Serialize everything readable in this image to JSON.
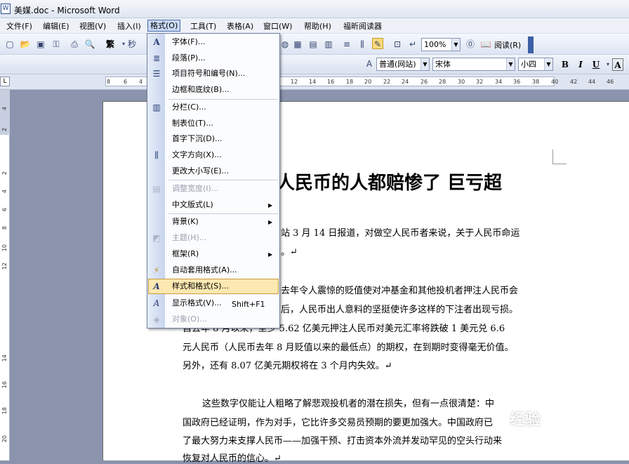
{
  "window": {
    "title": "美媒.doc - Microsoft Word"
  },
  "menubar": {
    "items": [
      "文件(F)",
      "编辑(E)",
      "视图(V)",
      "插入(I)",
      "格式(O)",
      "工具(T)",
      "表格(A)",
      "窗口(W)",
      "帮助(H)",
      "福昕阅读器"
    ]
  },
  "toolbar": {
    "zoom": "100%",
    "read_label": "阅读(R)",
    "char_label": "繁"
  },
  "format_toolbar": {
    "style": "普通(网站)",
    "font": "宋体",
    "size": "小四",
    "bold": "B",
    "italic": "I",
    "underline": "U",
    "fontcolor": "A"
  },
  "ruler": {
    "numbers": [
      "8",
      "6",
      "4",
      "12",
      "14",
      "16",
      "18",
      "20",
      "22",
      "24",
      "26",
      "28",
      "30",
      "32",
      "34",
      "36",
      "38",
      "40",
      "42",
      "44",
      "46"
    ]
  },
  "vruler": {
    "numbers": [
      "4",
      "2",
      "2",
      "4",
      "6",
      "8",
      "10",
      "12",
      "14",
      "16",
      "18",
      "20"
    ]
  },
  "format_menu": {
    "items": [
      {
        "label": "字体(F)...",
        "icon": "A"
      },
      {
        "label": "段落(P)...",
        "icon": "≣"
      },
      {
        "label": "项目符号和编号(N)...",
        "icon": "☰"
      },
      {
        "label": "边框和底纹(B)...",
        "icon": ""
      },
      {
        "label": "分栏(C)...",
        "icon": "▥"
      },
      {
        "label": "制表位(T)...",
        "icon": ""
      },
      {
        "label": "首字下沉(D)...",
        "icon": ""
      },
      {
        "label": "文字方向(X)...",
        "icon": "⫼"
      },
      {
        "label": "更改大小写(E)...",
        "icon": ""
      },
      {
        "label": "调整宽度(I)...",
        "icon": "▤"
      },
      {
        "label": "中文版式(L)",
        "icon": ""
      },
      {
        "label": "背景(K)",
        "icon": ""
      },
      {
        "label": "主题(H)...",
        "icon": "◩"
      },
      {
        "label": "框架(R)",
        "icon": ""
      },
      {
        "label": "自动套用格式(A)...",
        "icon": "⚡"
      },
      {
        "label": "样式和格式(S)...",
        "icon": "A"
      },
      {
        "label": "显示格式(V)...",
        "icon": "A"
      },
      {
        "label": "对象(O)...",
        "icon": "◈"
      }
    ],
    "shortcut": "Shift+F1"
  },
  "document": {
    "title_partial": "空人民币的人都赔惨了 巨亏超",
    "lines": [
      "站 3 月 14 日报道，对做空人民币者来说，关于人民币命运",
      "。↵",
      "去年令人震惊的贬值使对冲基金和其他投机者押注人民币会",
      "后，人民币出人意料的坚挺使许多这样的下注者出现亏损。",
      "自去年 8 月以来，至少 5.62 亿美元押注人民币对美元汇率将跌破 1 美元兑 6.6",
      "元人民币（人民币去年 8 月贬值以来的最低点）的期权，在到期时变得毫无价值。",
      "另外，还有 8.07 亿美元期权将在 3 个月内失效。↵",
      "这些数字仅能让人粗略了解悲观投机者的潜在损失，但有一点很清楚：中",
      "国政府已经证明，作为对手，它比许多交易员预期的要更加强大。中国政府已",
      "了最大努力来支撑人民币——加强干预、打击资本外流并发动罕见的空头行动来",
      "恢复对人民币的信心。↵"
    ]
  },
  "watermark": "经验"
}
